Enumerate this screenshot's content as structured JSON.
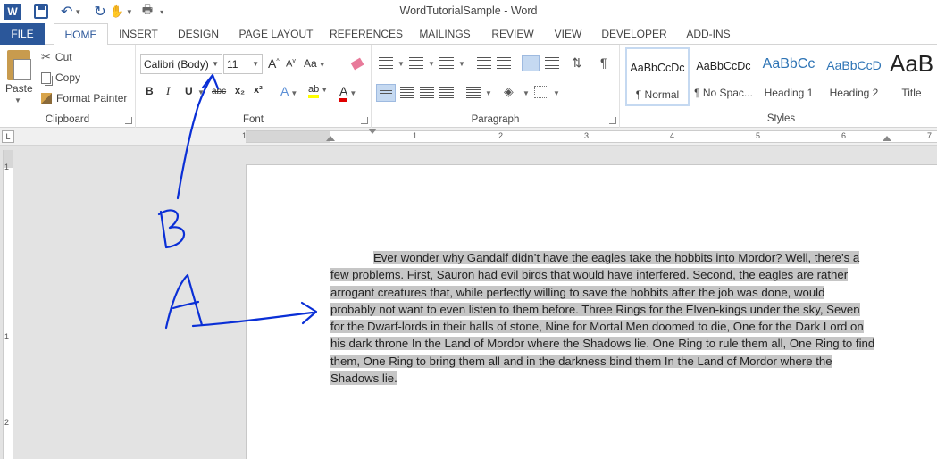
{
  "app": {
    "window_title": "WordTutorialSample - Word",
    "logo_letter": "W"
  },
  "tabs": [
    "FILE",
    "HOME",
    "INSERT",
    "DESIGN",
    "PAGE LAYOUT",
    "REFERENCES",
    "MAILINGS",
    "REVIEW",
    "VIEW",
    "DEVELOPER",
    "ADD-INS"
  ],
  "clipboard": {
    "paste_label": "Paste",
    "cut_label": "Cut",
    "copy_label": "Copy",
    "format_painter_label": "Format Painter",
    "group_label": "Clipboard"
  },
  "font": {
    "font_name": "Calibri (Body)",
    "font_size": "11",
    "bold": "B",
    "italic": "I",
    "underline": "U",
    "strike": "abc",
    "subscript": "x₂",
    "superscript": "x²",
    "grow": "A",
    "shrink": "A",
    "case": "Aa",
    "effects": "A",
    "highlight": "ab",
    "color": "A",
    "group_label": "Font"
  },
  "paragraph": {
    "group_label": "Paragraph",
    "show_marks": "¶"
  },
  "styles": {
    "group_label": "Styles",
    "items": [
      {
        "sample": "AaBbCcDc",
        "name": "¶ Normal"
      },
      {
        "sample": "AaBbCcDc",
        "name": "¶ No Spac..."
      },
      {
        "sample": "AaBbCc",
        "name": "Heading 1"
      },
      {
        "sample": "AaBbCcD",
        "name": "Heading 2"
      },
      {
        "sample": "AaB",
        "name": "Title"
      }
    ]
  },
  "ruler": {
    "numbers": [
      "1",
      "1",
      "2",
      "3",
      "4",
      "5",
      "6",
      "7"
    ],
    "vertical_numbers": [
      "1",
      "1",
      "2"
    ],
    "tab_selector": "L"
  },
  "document": {
    "lines": [
      "Ever wonder why Gandalf didn’t have the eagles take the hobbits into Mordor? Well, there’s a",
      "few problems. First, Sauron had evil birds that would have interfered. Second, the eagles are rather",
      "arrogant creatures that, while perfectly willing to save the hobbits after the job was done, would",
      "probably not want to even listen to them before. Three Rings for the Elven-kings under the sky, Seven",
      "for the Dwarf-lords in their halls of stone, Nine for Mortal Men doomed to die, One for the Dark Lord on",
      "his dark throne In the Land of Mordor where the Shadows lie. One Ring to rule them all, One Ring to find",
      "them, One Ring to bring them all and in the darkness bind them In the Land of Mordor where the",
      "Shadows lie."
    ]
  },
  "annotations": {
    "a_label": "A",
    "b_label": "B",
    "stroke_color": "#0a2fd6"
  },
  "colors": {
    "accent": "#2b579a",
    "selection": "#c6c6c6"
  }
}
